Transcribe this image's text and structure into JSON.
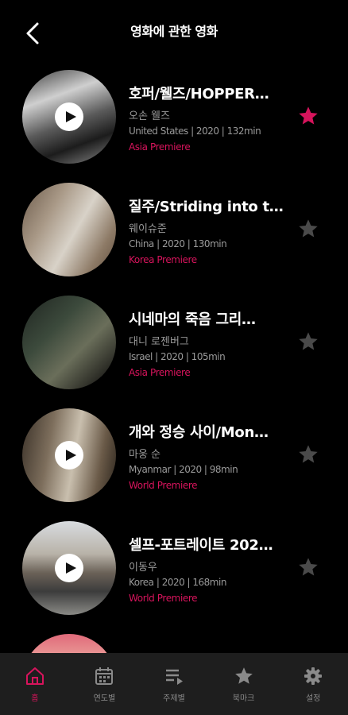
{
  "header": {
    "title": "영화에 관한 영화"
  },
  "movies": [
    {
      "title": "호퍼/웰즈/HOPPER…",
      "director": "오손 웰즈",
      "meta": "United States | 2020 | 132min",
      "premiere": "Asia Premiere",
      "bookmarked": true
    },
    {
      "title": "질주/Striding into t…",
      "director": "웨이슈준",
      "meta": "China | 2020 | 130min",
      "premiere": "Korea Premiere",
      "bookmarked": false
    },
    {
      "title": "시네마의 죽음 그리…",
      "director": "대니 로젠버그",
      "meta": "Israel | 2020 | 105min",
      "premiere": "Asia Premiere",
      "bookmarked": false
    },
    {
      "title": "개와 정승 사이/Mon…",
      "director": "마웅 순",
      "meta": "Myanmar | 2020 | 98min",
      "premiere": "World Premiere",
      "bookmarked": false
    },
    {
      "title": "셀프-포트레이트 202…",
      "director": "이동우",
      "meta": "Korea | 2020 | 168min",
      "premiere": "World Premiere",
      "bookmarked": false
    }
  ],
  "tabs": [
    {
      "label": "홈",
      "icon": "home-icon",
      "active": true
    },
    {
      "label": "연도별",
      "icon": "calendar-icon",
      "active": false
    },
    {
      "label": "주제별",
      "icon": "playlist-icon",
      "active": false
    },
    {
      "label": "북마크",
      "icon": "star-icon",
      "active": false
    },
    {
      "label": "설정",
      "icon": "gear-icon",
      "active": false
    }
  ],
  "colors": {
    "accent": "#d7145c",
    "star_inactive": "#4a4a4a",
    "tabbar": "#1e1e1e"
  }
}
